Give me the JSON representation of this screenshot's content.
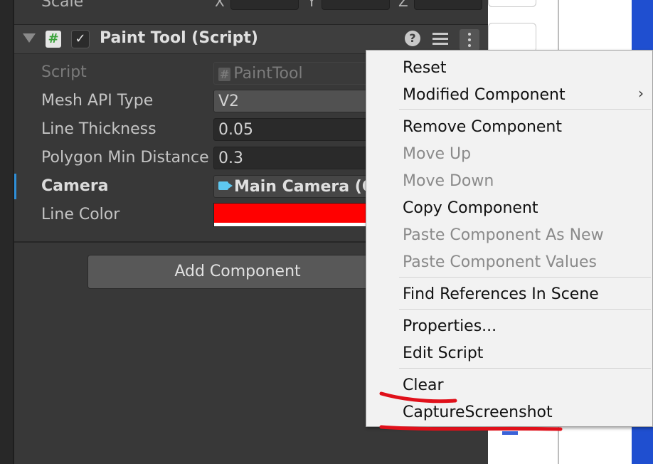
{
  "transform": {
    "scale_label": "Scale",
    "x_axis": "X",
    "y_axis": "Y",
    "z_axis": "Z"
  },
  "component": {
    "title": "Paint Tool (Script)",
    "script_icon_glyph": "#",
    "enabled_glyph": "✓",
    "help_glyph": "?"
  },
  "properties": {
    "script_label": "Script",
    "script_value": "PaintTool",
    "script_hash": "#",
    "mesh_api_label": "Mesh API Type",
    "mesh_api_value": "V2",
    "line_thickness_label": "Line Thickness",
    "line_thickness_value": "0.05",
    "polygon_min_label": "Polygon Min Distance",
    "polygon_min_value": "0.3",
    "camera_label": "Camera",
    "camera_value": "Main Camera (C",
    "line_color_label": "Line Color",
    "line_color_hex": "#ff0000"
  },
  "add_component_label": "Add Component",
  "context_menu": {
    "items": [
      {
        "label": "Reset",
        "enabled": true
      },
      {
        "label": "Modified Component",
        "enabled": true,
        "submenu_glyph": "›"
      },
      {
        "label": "Remove Component",
        "enabled": true
      },
      {
        "label": "Move Up",
        "enabled": false
      },
      {
        "label": "Move Down",
        "enabled": false
      },
      {
        "label": "Copy Component",
        "enabled": true
      },
      {
        "label": "Paste Component As New",
        "enabled": false
      },
      {
        "label": "Paste Component Values",
        "enabled": false
      },
      {
        "label": "Find References In Scene",
        "enabled": true
      },
      {
        "label": "Properties...",
        "enabled": true
      },
      {
        "label": "Edit Script",
        "enabled": true
      },
      {
        "label": "Clear",
        "enabled": true
      },
      {
        "label": "CaptureScreenshot",
        "enabled": true
      }
    ]
  },
  "colors": {
    "inspector_bg": "#383838",
    "menu_bg": "#f2f2f2",
    "annotation_red": "#e0101a",
    "scene_blue": "#1f4fd0"
  }
}
